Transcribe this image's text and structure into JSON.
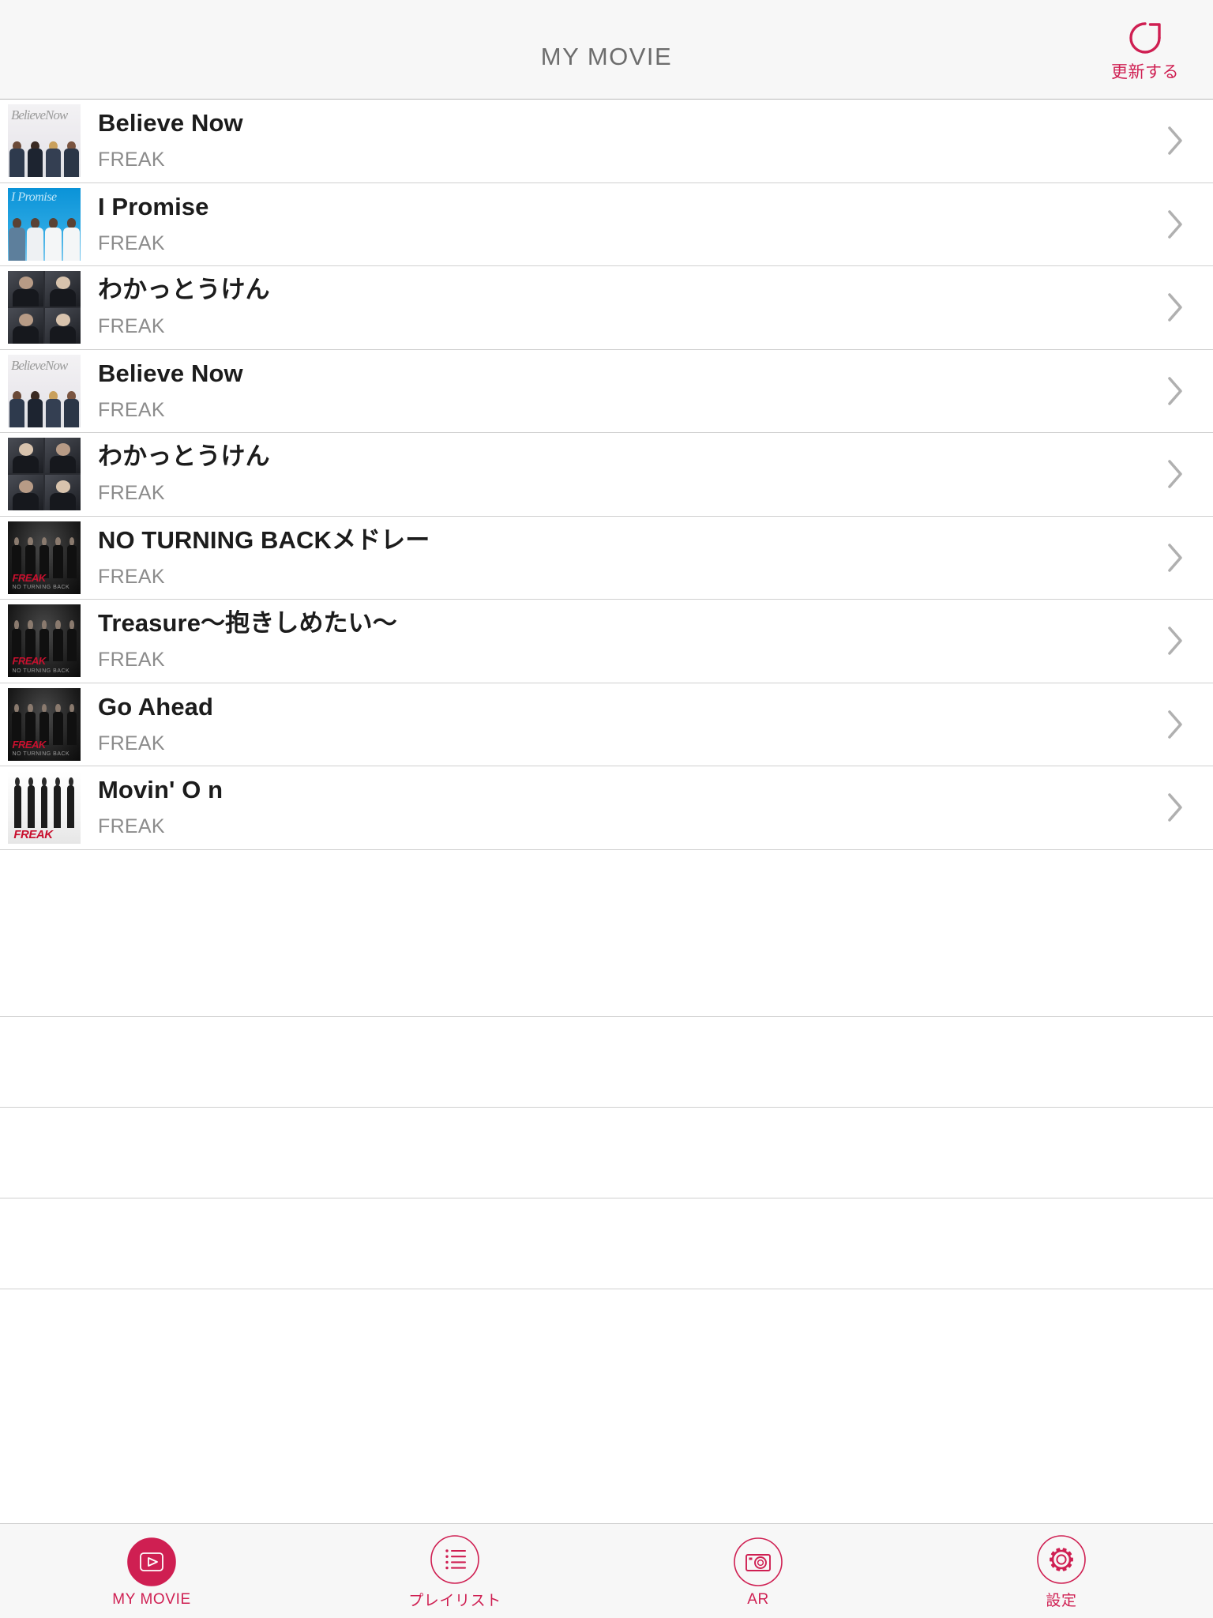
{
  "header": {
    "title": "MY MOVIE",
    "refresh_label": "更新する",
    "refresh_icon": "refresh-icon",
    "accent_color": "#cf1f52",
    "title_color": "#6d6d6d",
    "background": "#f7f7f7"
  },
  "list": {
    "artist_default": "FREAK",
    "chevron_icon": "chevron-right-icon",
    "items": [
      {
        "title": "Believe Now",
        "artist": "FREAK",
        "art": "believe",
        "art_caption": "BelieveNow"
      },
      {
        "title": "I Promise",
        "artist": "FREAK",
        "art": "promise",
        "art_caption": "I Promise"
      },
      {
        "title": "わかっとうけん",
        "artist": "FREAK",
        "art": "wakatto",
        "art_caption": ""
      },
      {
        "title": "Believe Now",
        "artist": "FREAK",
        "art": "believe",
        "art_caption": "BelieveNow"
      },
      {
        "title": "わかっとうけん",
        "artist": "FREAK",
        "art": "wakatto2",
        "art_caption": ""
      },
      {
        "title": "NO TURNING BACKメドレー",
        "artist": "FREAK",
        "art": "ntb",
        "art_caption": "FREAK"
      },
      {
        "title": "Treasure〜抱きしめたい〜",
        "artist": "FREAK",
        "art": "ntb",
        "art_caption": "FREAK"
      },
      {
        "title": "Go Ahead",
        "artist": "FREAK",
        "art": "ntb",
        "art_caption": "FREAK"
      },
      {
        "title": "Movin' O n",
        "artist": "FREAK",
        "art": "movin",
        "art_caption": "FREAK"
      }
    ],
    "empty_row_count": 4
  },
  "tabbar": {
    "accent_color": "#cf1f52",
    "active_index": 0,
    "tabs": [
      {
        "label": "MY MOVIE",
        "icon": "play-circle-icon",
        "active": true
      },
      {
        "label": "プレイリスト",
        "icon": "playlist-icon",
        "active": false
      },
      {
        "label": "AR",
        "icon": "camera-icon",
        "active": false
      },
      {
        "label": "設定",
        "icon": "gear-icon",
        "active": false
      }
    ]
  }
}
